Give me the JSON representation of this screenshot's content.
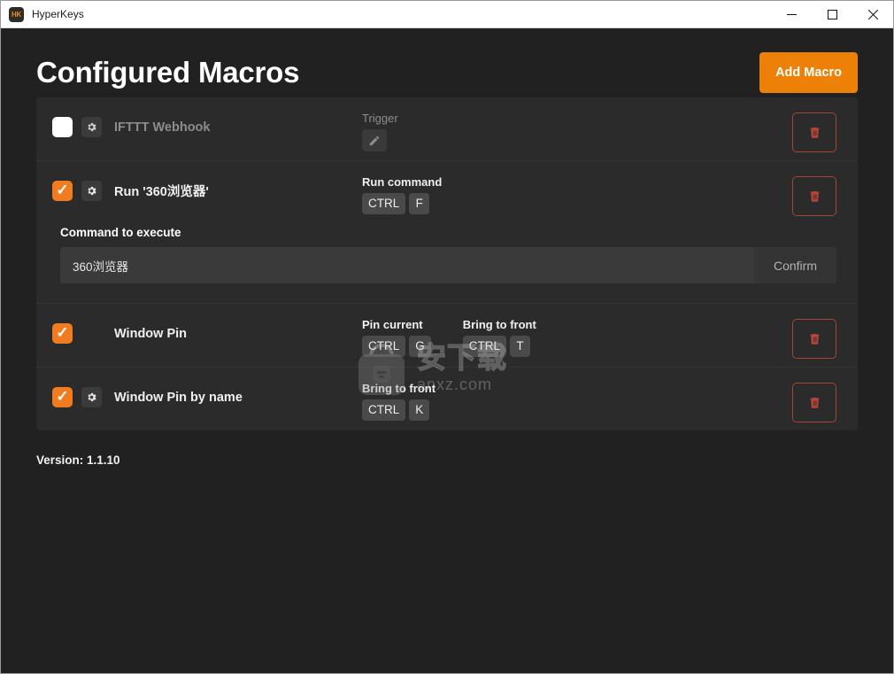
{
  "window": {
    "app_icon_label": "HK",
    "title": "HyperKeys",
    "controls": {
      "minimize": "minimize-icon",
      "maximize": "maximize-icon",
      "close": "close-icon"
    }
  },
  "header": {
    "title": "Configured Macros",
    "add_macro_label": "Add Macro",
    "accent_color": "#ed8007"
  },
  "macros": [
    {
      "enabled": false,
      "has_gear": true,
      "name": "IFTTT Webhook",
      "triggers": [
        {
          "label": "Trigger",
          "keys": [],
          "edit_icon": "pencil-icon",
          "muted": true
        }
      ],
      "delete_icon": "trash-icon"
    },
    {
      "enabled": true,
      "has_gear": true,
      "name": "Run '360浏览器'",
      "triggers": [
        {
          "label": "Run command",
          "keys": [
            "CTRL",
            "F"
          ],
          "muted": false
        }
      ],
      "delete_icon": "trash-icon",
      "expanded": {
        "field_label": "Command to execute",
        "value": "360浏览器",
        "placeholder": "",
        "confirm_label": "Confirm"
      }
    },
    {
      "enabled": true,
      "has_gear": false,
      "name": "Window Pin",
      "triggers": [
        {
          "label": "Pin current",
          "keys": [
            "CTRL",
            "G"
          ],
          "muted": false
        },
        {
          "label": "Bring to front",
          "keys": [
            "CTRL",
            "T"
          ],
          "muted": false
        }
      ],
      "delete_icon": "trash-icon"
    },
    {
      "enabled": true,
      "has_gear": true,
      "name": "Window Pin by name",
      "triggers": [
        {
          "label": "Bring to front",
          "keys": [
            "CTRL",
            "K"
          ],
          "muted": false
        }
      ],
      "delete_icon": "trash-icon"
    }
  ],
  "footer": {
    "version": "Version: 1.1.10"
  },
  "watermark": {
    "cn_text": "安下载",
    "url_text": "anxz.com"
  },
  "colors": {
    "page_background": "#212121",
    "panel_background": "#2b2b2b",
    "accent": "#ed8007",
    "checkbox_checked": "#f07c1f",
    "danger": "#a64437"
  }
}
